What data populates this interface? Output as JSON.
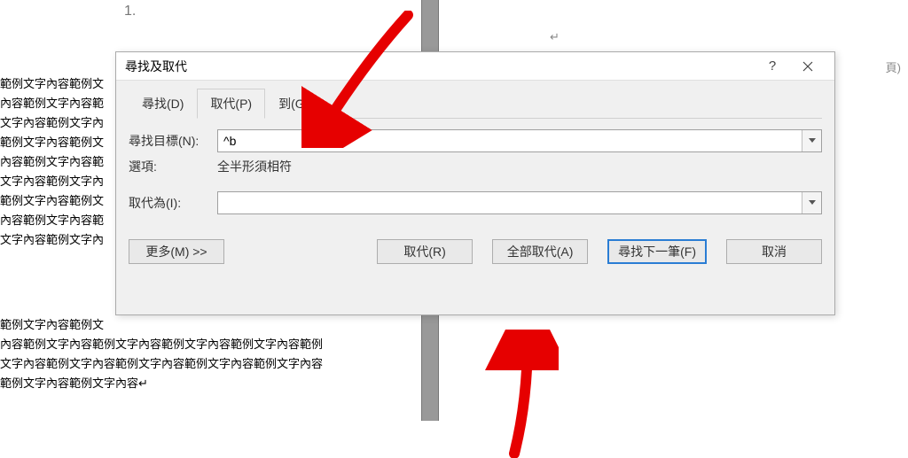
{
  "background": {
    "page_number": "1.",
    "paragraph_mark": "↵",
    "page_header_label": "頁)",
    "left_lines": [
      "範例文字內容範例文",
      "內容範例文字內容範",
      "文字內容範例文字內",
      "範例文字內容範例文",
      "內容範例文字內容範",
      "文字內容範例文字內",
      "範例文字內容範例文",
      "內容範例文字內容範",
      "文字內容範例文字內"
    ],
    "cont_lines": [
      "範例文字內容範例文",
      "內容範例文字內容範例文字內容範例文字內容範例文字內容範例",
      "文字內容範例文字內容範例文字內容範例文字內容範例文字內容",
      "範例文字內容範例文字內容↵"
    ]
  },
  "dialog": {
    "title": "尋找及取代",
    "help_label": "?",
    "tabs": {
      "find": "尋找(D)",
      "replace": "取代(P)",
      "goto": "到(G)"
    },
    "find": {
      "label": "尋找目標(N):",
      "value": "^b"
    },
    "options": {
      "label": "選項:",
      "value": "全半形須相符"
    },
    "replace": {
      "label": "取代為(I):",
      "value": ""
    },
    "buttons": {
      "more": "更多(M) >>",
      "replace": "取代(R)",
      "replace_all": "全部取代(A)",
      "find_next": "尋找下一筆(F)",
      "cancel": "取消"
    }
  },
  "icons": {
    "help": "help-icon",
    "close": "close-icon",
    "chevron_down": "chevron-down-icon"
  },
  "annotations": {
    "arrow_color": "#e60000"
  }
}
